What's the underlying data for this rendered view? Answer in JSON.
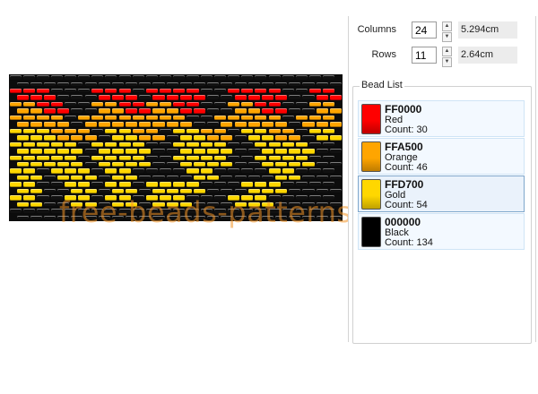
{
  "settings": {
    "columns_label": "Columns",
    "columns_value": "24",
    "columns_size": "5.294cm",
    "rows_label": "Rows",
    "rows_value": "11",
    "rows_size": "2.64cm"
  },
  "bead_list": {
    "title": "Bead List",
    "items": [
      {
        "hex": "FF0000",
        "name": "Red",
        "count": "Count: 30",
        "color": "#ff0000"
      },
      {
        "hex": "FFA500",
        "name": "Orange",
        "count": "Count: 46",
        "color": "#ffa500"
      },
      {
        "hex": "FFD700",
        "name": "Gold",
        "count": "Count: 54",
        "color": "#ffd700"
      },
      {
        "hex": "000000",
        "name": "Black",
        "count": "Count: 134",
        "color": "#000000"
      }
    ]
  },
  "watermark": "free-beads-patterns.com",
  "pattern": {
    "palette": {
      "R": "#ff0000",
      "O": "#ffa500",
      "G": "#ffd700",
      "K": "#111111"
    },
    "rows": [
      "KKKKKKKKKKKKKKKKKKKKKKKK",
      "RRRKKKRRRKRRRRKKRRRRKKRR",
      "OORRKKOORROORRKKOORRKKOO",
      "OOOOKOOOOOOOOKKOOOOOKOOO",
      "GGGOOOKGGOOKGGOOKGGOOKGG",
      "GGGGGKGGGGKKGGGGKKGGGGKK",
      "GGGGGKGGGGKKGGGGKKGGGGKK",
      "GGKGGGKGGKKKKGGKKKKGGKKK",
      "GGKKGGKGGKGGGGKKKGGGKKKK",
      "GGKKGGKGGKGGGKKKGGGKKKKK",
      "KKKKKKKKKKKKKKKKKKKKKKKK"
    ]
  }
}
